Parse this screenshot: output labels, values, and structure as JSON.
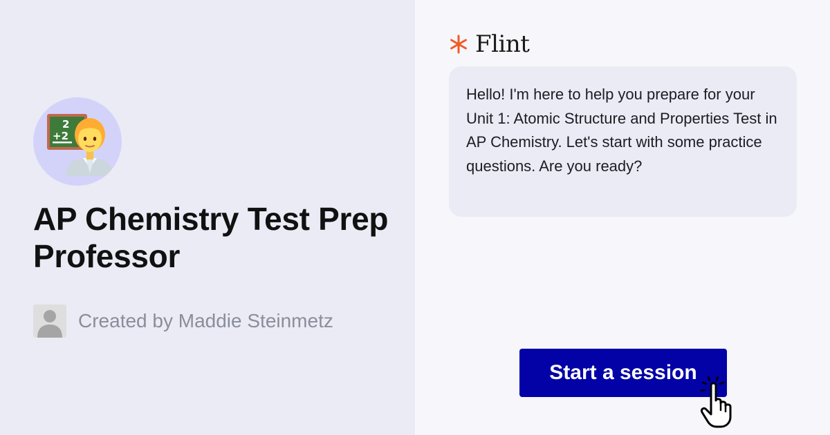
{
  "agent": {
    "avatar_icon": "teacher-emoji-icon",
    "title": "AP Chemistry Test Prep Professor",
    "creator_avatar_icon": "user-silhouette-icon",
    "creator_text": "Created by Maddie Steinmetz"
  },
  "brand": {
    "logo_icon": "asterisk-logo-icon",
    "name": "Flint",
    "accent_color": "#f15a24"
  },
  "chat": {
    "message": "Hello! I'm here to help you prepare for your Unit 1: Atomic Structure and Properties Test in AP Chemistry. Let's start with some practice questions. Are you ready?"
  },
  "cta": {
    "label": "Start a session",
    "color": "#0202a6",
    "cursor_icon": "hand-pointer-icon"
  }
}
